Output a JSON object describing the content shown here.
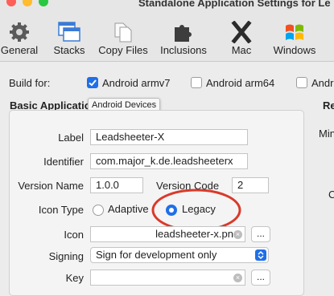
{
  "window": {
    "title": "Standalone Application Settings for Le"
  },
  "toolbar": {
    "items": [
      {
        "label": "General"
      },
      {
        "label": "Stacks"
      },
      {
        "label": "Copy Files"
      },
      {
        "label": "Inclusions"
      },
      {
        "label": "Mac"
      },
      {
        "label": "Windows"
      }
    ]
  },
  "build_for": {
    "label": "Build for:",
    "options": [
      {
        "label": "Android armv7",
        "checked": true
      },
      {
        "label": "Android arm64",
        "checked": false
      },
      {
        "label": "Andr",
        "checked": false
      }
    ]
  },
  "section": {
    "title": "Basic Applicatio",
    "right_title": "Re",
    "right_min": "Min",
    "right_c": "C",
    "tooltip": "Android Devices"
  },
  "form": {
    "label": {
      "label": "Label",
      "value": "Leadsheeter-X"
    },
    "identifier": {
      "label": "Identifier",
      "value": "com.major_k.de.leadsheeterx"
    },
    "version_name": {
      "label": "Version Name",
      "value": "1.0.0"
    },
    "version_code": {
      "label": "Version Code",
      "value": "2"
    },
    "icon_type": {
      "label": "Icon Type",
      "options": [
        {
          "label": "Adaptive",
          "selected": false
        },
        {
          "label": "Legacy",
          "selected": true
        }
      ]
    },
    "icon": {
      "label": "Icon",
      "value": "leadsheeter-x.pn",
      "browse": "..."
    },
    "signing": {
      "label": "Signing",
      "value": "Sign for development only"
    },
    "key": {
      "label": "Key",
      "value": "",
      "browse": "..."
    }
  },
  "colors": {
    "accent": "#1f6fe8",
    "annotation": "#d93a2a"
  }
}
